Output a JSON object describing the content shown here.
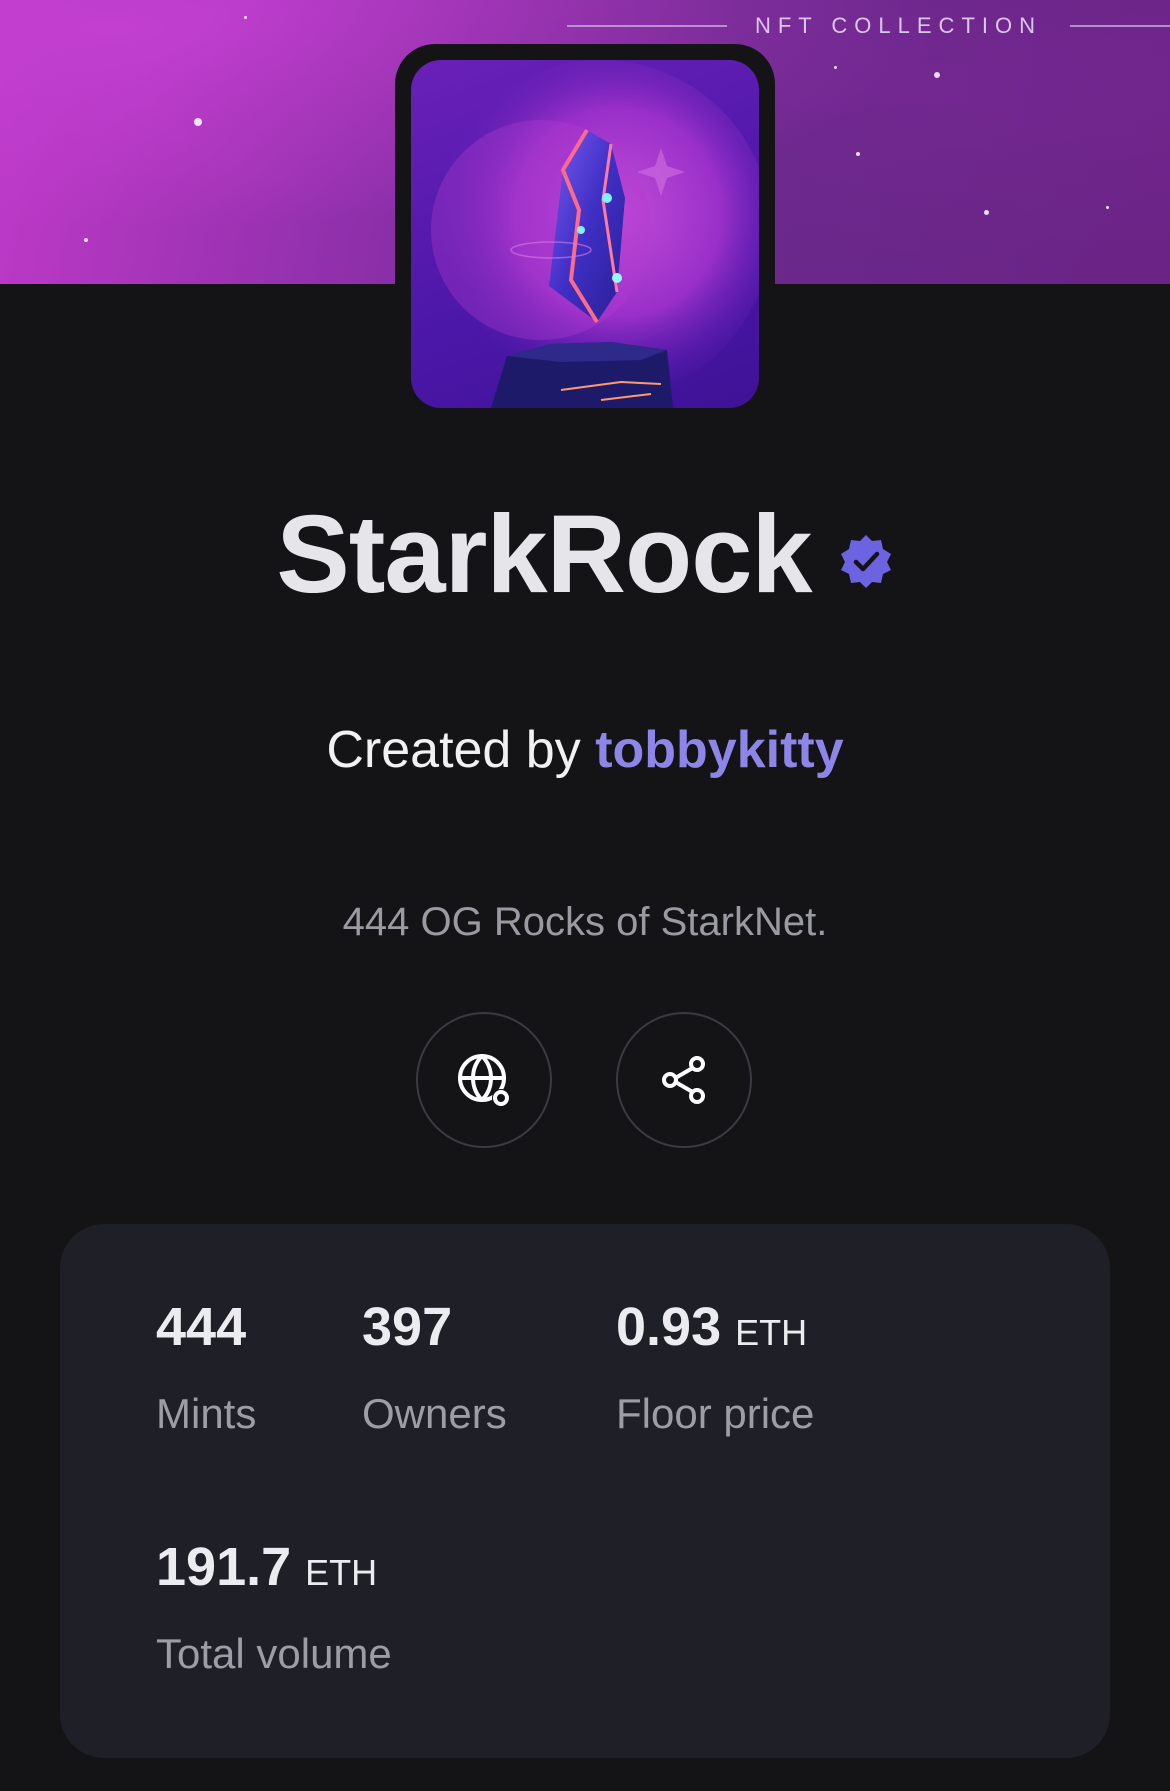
{
  "banner": {
    "caption": "NFT COLLECTION"
  },
  "collection": {
    "name": "StarkRock",
    "verified": true,
    "created_by_prefix": "Created by",
    "creator": "tobbykitty",
    "description": "444 OG Rocks of StarkNet."
  },
  "actions": [
    {
      "icon": "globe-icon",
      "name": "website"
    },
    {
      "icon": "share-icon",
      "name": "share"
    }
  ],
  "stats": {
    "mints": {
      "value": "444",
      "label": "Mints"
    },
    "owners": {
      "value": "397",
      "label": "Owners"
    },
    "floor_price": {
      "value": "0.93",
      "unit": "ETH",
      "label": "Floor price"
    },
    "total_volume": {
      "value": "191.7",
      "unit": "ETH",
      "label": "Total volume"
    }
  },
  "colors": {
    "background": "#141416",
    "accent": "#8d86e8",
    "verified_badge": "#6c63e0",
    "card": "#1f1f27"
  }
}
